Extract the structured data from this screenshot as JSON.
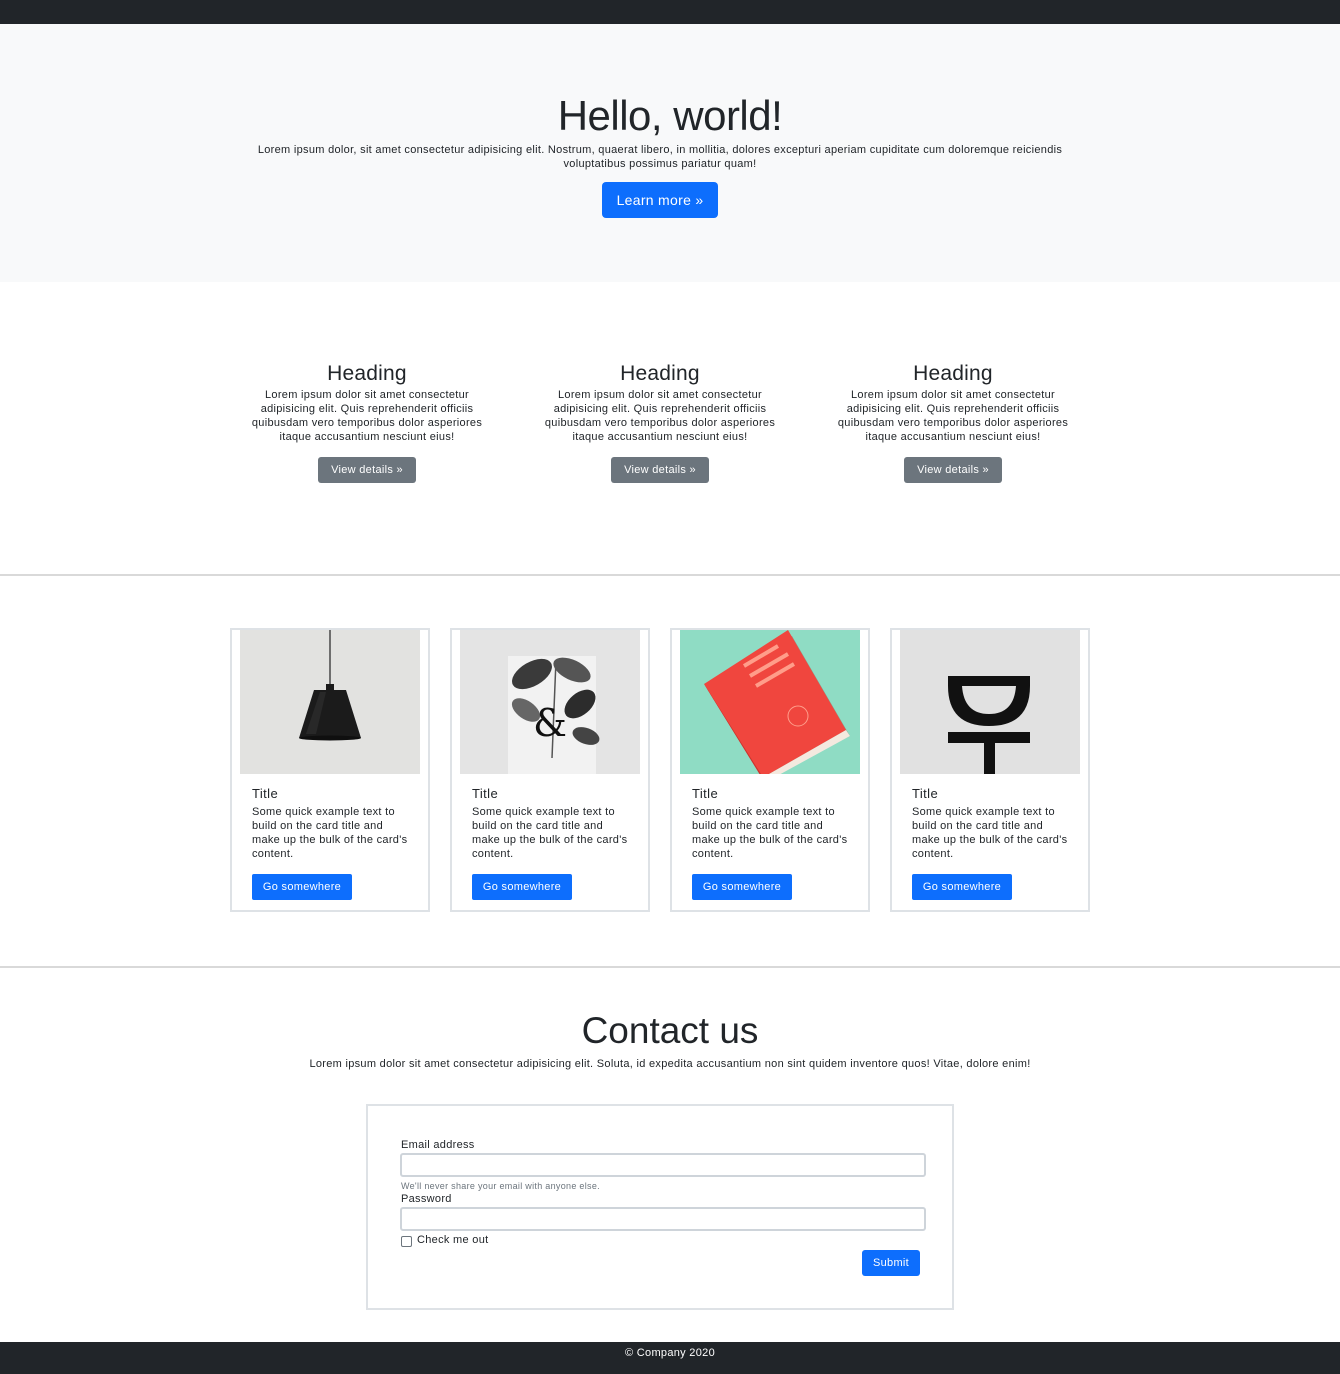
{
  "hero": {
    "title": "Hello, world!",
    "lead": "Lorem ipsum dolor, sit amet consectetur adipisicing elit. Nostrum, quaerat libero, in mollitia, dolores excepturi aperiam cupiditate cum doloremque reiciendis voluptatibus possimus pariatur quam!",
    "button": "Learn more »"
  },
  "features": [
    {
      "heading": "Heading",
      "text": "Lorem ipsum dolor sit amet consectetur adipisicing elit. Quis reprehenderit officiis quibusdam vero temporibus dolor asperiores itaque accusantium nesciunt eius!",
      "button": "View details »"
    },
    {
      "heading": "Heading",
      "text": "Lorem ipsum dolor sit amet consectetur adipisicing elit. Quis reprehenderit officiis quibusdam vero temporibus dolor asperiores itaque accusantium nesciunt eius!",
      "button": "View details »"
    },
    {
      "heading": "Heading",
      "text": "Lorem ipsum dolor sit amet consectetur adipisicing elit. Quis reprehenderit officiis quibusdam vero temporibus dolor asperiores itaque accusantium nesciunt eius!",
      "button": "View details »"
    }
  ],
  "cards": [
    {
      "image": "pendant-lamp-image",
      "title": "Title",
      "text": "Some quick example text to build on the card title and make up the bulk of the card's content.",
      "button": "Go somewhere"
    },
    {
      "image": "ampersand-poster-image",
      "title": "Title",
      "text": "Some quick example text to build on the card title and make up the bulk of the card's content.",
      "button": "Go somewhere"
    },
    {
      "image": "red-book-image",
      "title": "Title",
      "text": "Some quick example text to build on the card title and make up the bulk of the card's content.",
      "button": "Go somewhere"
    },
    {
      "image": "glyph-logo-image",
      "title": "Title",
      "text": "Some quick example text to build on the card title and make up the bulk of the card's content.",
      "button": "Go somewhere"
    }
  ],
  "contact": {
    "title": "Contact us",
    "lead": "Lorem ipsum dolor sit amet consectetur adipisicing elit. Soluta, id expedita accusantium non sint quidem inventore quos! Vitae, dolore enim!",
    "email_label": "Email address",
    "email_value": "",
    "email_help": "We'll never share your email with anyone else.",
    "password_label": "Password",
    "password_value": "",
    "checkbox_label": "Check me out",
    "checkbox_checked": false,
    "submit": "Submit"
  },
  "footer": {
    "text": "© Company 2020"
  },
  "colors": {
    "primary": "#0d6efd",
    "secondary": "#6c757d",
    "dark": "#212529",
    "light": "#f8f9fa"
  }
}
